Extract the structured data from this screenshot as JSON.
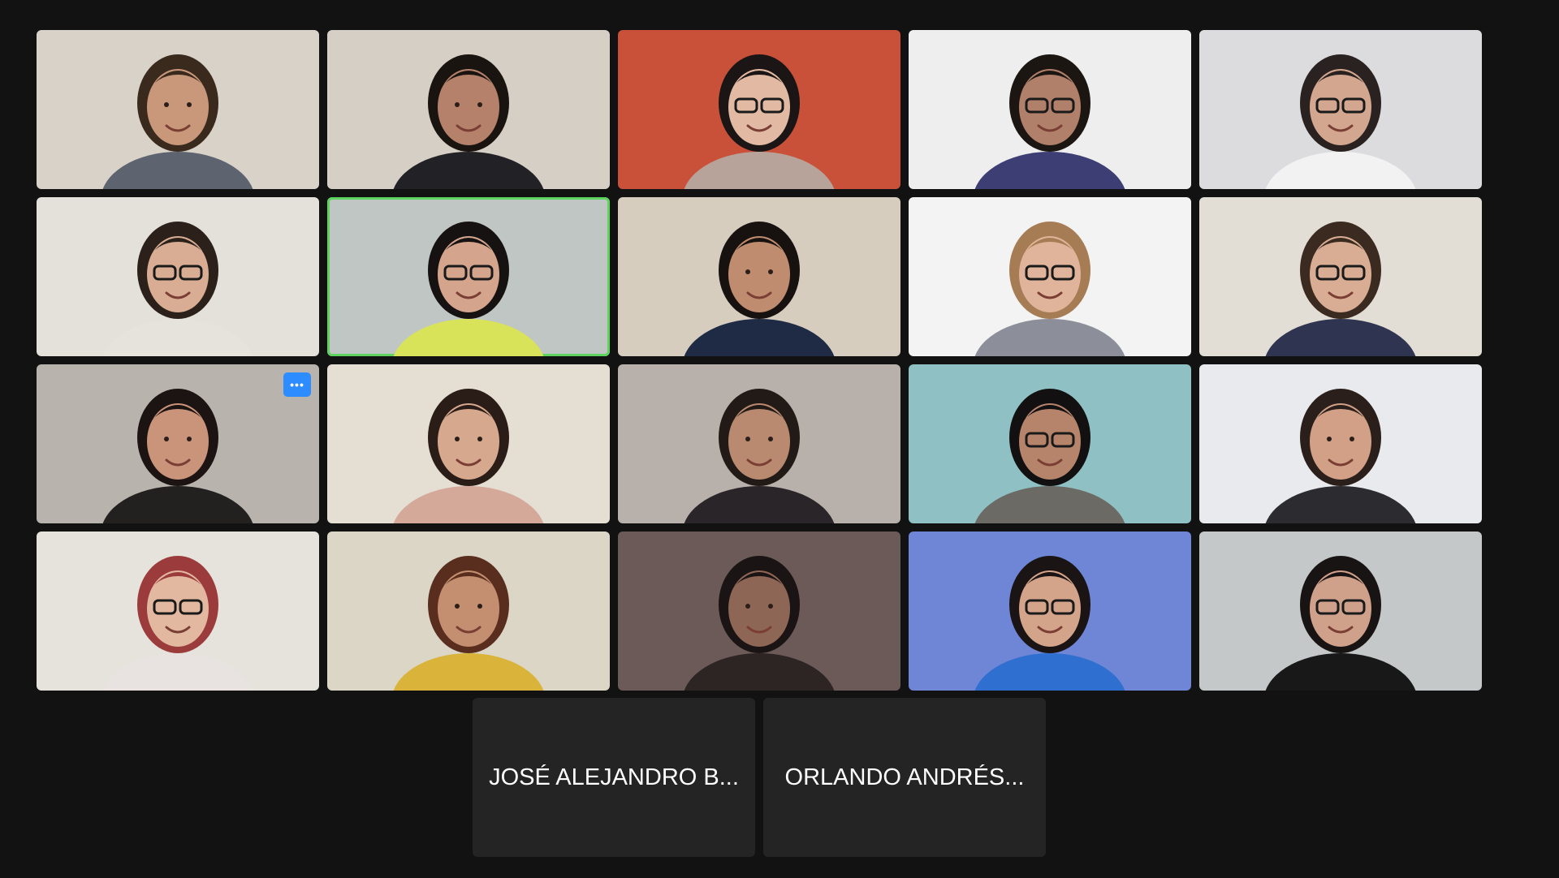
{
  "colors": {
    "background": "#121212",
    "active_speaker_border": "#5fd35f",
    "more_button": "#2d8cff"
  },
  "video_tiles": [
    {
      "bg": "#d9d2c8",
      "skin": "#c9987a",
      "hair": "#3a2a1e",
      "shirt": "#5d6470",
      "glasses": false,
      "icon": "participant-video-icon"
    },
    {
      "bg": "#d6cfc6",
      "skin": "#b5816a",
      "hair": "#1a1410",
      "shirt": "#222226",
      "glasses": false,
      "icon": "participant-video-icon"
    },
    {
      "bg": "#c9513a",
      "skin": "#e2b9a2",
      "hair": "#1b1615",
      "shirt": "#b8a39a",
      "glasses": true,
      "icon": "participant-video-icon"
    },
    {
      "bg": "#eeeeee",
      "skin": "#b0806a",
      "hair": "#1c1612",
      "shirt": "#3c3e74",
      "glasses": true,
      "icon": "participant-video-icon"
    },
    {
      "bg": "#dcdcdf",
      "skin": "#d3a78f",
      "hair": "#2a2221",
      "shirt": "#f2f2f2",
      "glasses": true,
      "icon": "participant-video-icon"
    },
    {
      "bg": "#e4e0da",
      "skin": "#d8ad93",
      "hair": "#2b201a",
      "shirt": "#e6e2dc",
      "glasses": true,
      "icon": "participant-video-icon"
    },
    {
      "bg": "#bfc6c4",
      "skin": "#d4a48c",
      "hair": "#161212",
      "shirt": "#d9e35a",
      "glasses": true,
      "icon": "participant-video-icon"
    },
    {
      "bg": "#d7cdbf",
      "skin": "#c08c6f",
      "hair": "#17120f",
      "shirt": "#1f2a44",
      "glasses": false,
      "icon": "participant-video-icon"
    },
    {
      "bg": "#f3f3f3",
      "skin": "#e0b49a",
      "hair": "#a67c55",
      "shirt": "#8c8f99",
      "glasses": true,
      "icon": "participant-video-icon"
    },
    {
      "bg": "#e2ddd5",
      "skin": "#d9ad93",
      "hair": "#3a2a20",
      "shirt": "#2f3451",
      "glasses": true,
      "icon": "participant-video-icon"
    },
    {
      "bg": "#b9b3ad",
      "skin": "#c99479",
      "hair": "#1c1412",
      "shirt": "#232020",
      "glasses": false,
      "icon": "participant-video-icon"
    },
    {
      "bg": "#e5ded2",
      "skin": "#d6a88e",
      "hair": "#2a1c16",
      "shirt": "#d4a99a",
      "glasses": false,
      "icon": "participant-video-icon"
    },
    {
      "bg": "#b8b0aa",
      "skin": "#b98a70",
      "hair": "#221a17",
      "shirt": "#2a2528",
      "glasses": false,
      "icon": "participant-video-icon"
    },
    {
      "bg": "#8fc0c4",
      "skin": "#b5846b",
      "hair": "#121010",
      "shirt": "#6c6a64",
      "glasses": true,
      "icon": "participant-video-icon"
    },
    {
      "bg": "#e8eaee",
      "skin": "#d1a086",
      "hair": "#2a1f1a",
      "shirt": "#2c2c30",
      "glasses": false,
      "icon": "participant-video-icon"
    },
    {
      "bg": "#e6e2dc",
      "skin": "#e2b8a0",
      "hair": "#9b3b3b",
      "shirt": "#e8e2e0",
      "glasses": true,
      "icon": "participant-video-icon"
    },
    {
      "bg": "#dcd6c6",
      "skin": "#c48e70",
      "hair": "#5a2e1e",
      "shirt": "#d9b33a",
      "glasses": false,
      "icon": "participant-video-icon"
    },
    {
      "bg": "#6b5a58",
      "skin": "#8e6656",
      "hair": "#1b1414",
      "shirt": "#2d2424",
      "glasses": false,
      "icon": "participant-video-icon"
    },
    {
      "bg": "#6f86d6",
      "skin": "#d3a48a",
      "hair": "#1a1414",
      "shirt": "#2f6fd0",
      "glasses": true,
      "icon": "participant-video-icon"
    },
    {
      "bg": "#c4c8c9",
      "skin": "#cfa08a",
      "hair": "#181414",
      "shirt": "#181818",
      "glasses": true,
      "icon": "participant-video-icon"
    }
  ],
  "more_options": {
    "label": "•••",
    "icon": "more-options-icon"
  },
  "name_tiles": [
    {
      "name": "JOSÉ ALEJANDRO B..."
    },
    {
      "name": "ORLANDO ANDRÉS..."
    }
  ]
}
